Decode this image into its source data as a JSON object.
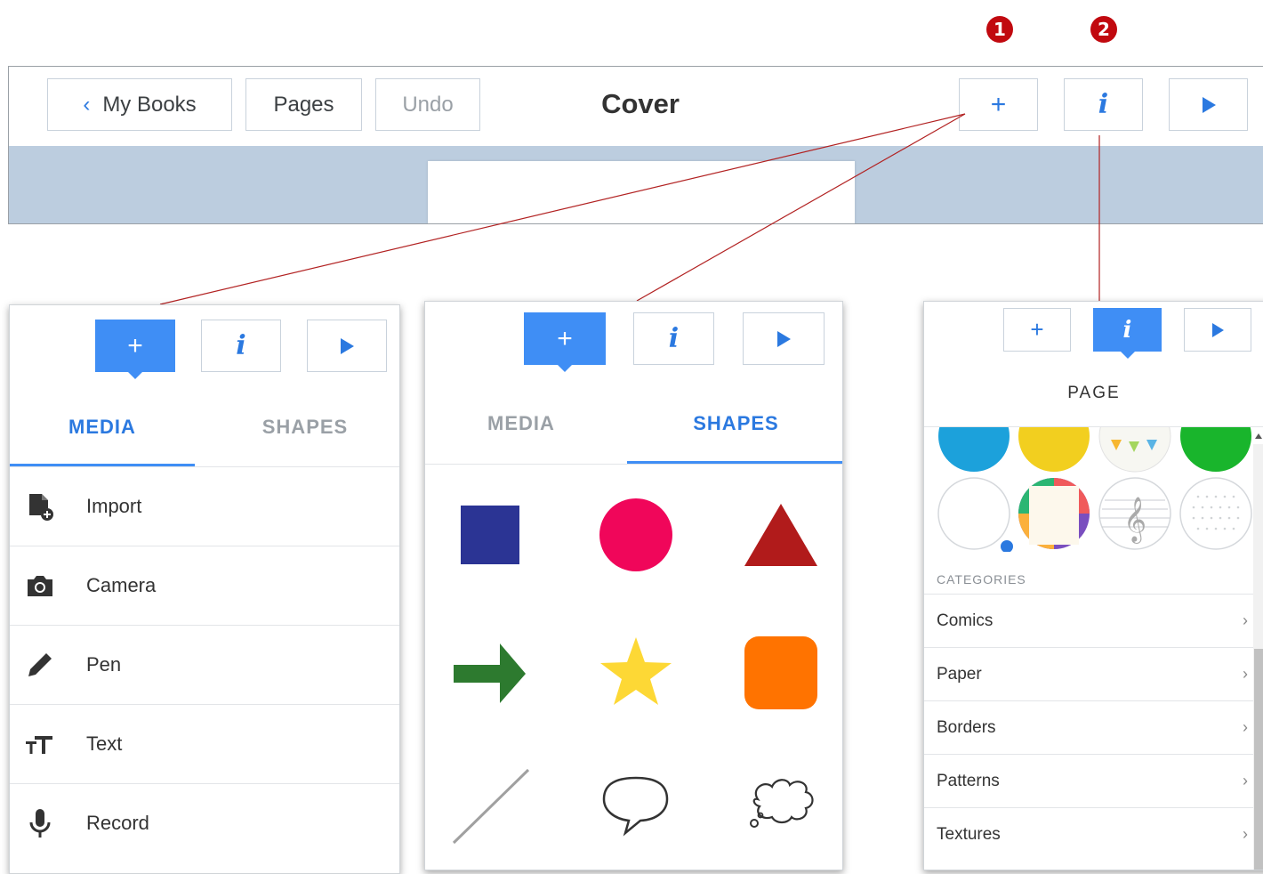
{
  "callouts": [
    "1",
    "2"
  ],
  "toolbar": {
    "back_label": "My Books",
    "pages_label": "Pages",
    "undo_label": "Undo",
    "title": "Cover"
  },
  "left_panel": {
    "tabs": [
      "MEDIA",
      "SHAPES"
    ],
    "active_tab": "MEDIA",
    "items": [
      {
        "label": "Import",
        "icon": "import-icon"
      },
      {
        "label": "Camera",
        "icon": "camera-icon"
      },
      {
        "label": "Pen",
        "icon": "pen-icon"
      },
      {
        "label": "Text",
        "icon": "text-icon"
      },
      {
        "label": "Record",
        "icon": "microphone-icon"
      }
    ]
  },
  "middle_panel": {
    "tabs": [
      "MEDIA",
      "SHAPES"
    ],
    "active_tab": "SHAPES",
    "shapes": [
      {
        "name": "square",
        "color": "#2b3494"
      },
      {
        "name": "circle",
        "color": "#f0065a"
      },
      {
        "name": "triangle",
        "color": "#b11b1b"
      },
      {
        "name": "arrow",
        "color": "#2d7a2f"
      },
      {
        "name": "star",
        "color": "#fdd835"
      },
      {
        "name": "rounded-square",
        "color": "#ff7300"
      },
      {
        "name": "line",
        "color": "#9e9e9e"
      },
      {
        "name": "speech-bubble",
        "color": "#333333"
      },
      {
        "name": "thought-bubble",
        "color": "#333333"
      }
    ]
  },
  "right_panel": {
    "heading": "PAGE",
    "categories_heading": "CATEGORIES",
    "categories": [
      "Comics",
      "Paper",
      "Borders",
      "Patterns",
      "Textures"
    ]
  },
  "colors": {
    "accent": "#3f8ef5",
    "icon_blue": "#2b79e0",
    "callout_red": "#c1090f",
    "connector": "#b22222"
  }
}
